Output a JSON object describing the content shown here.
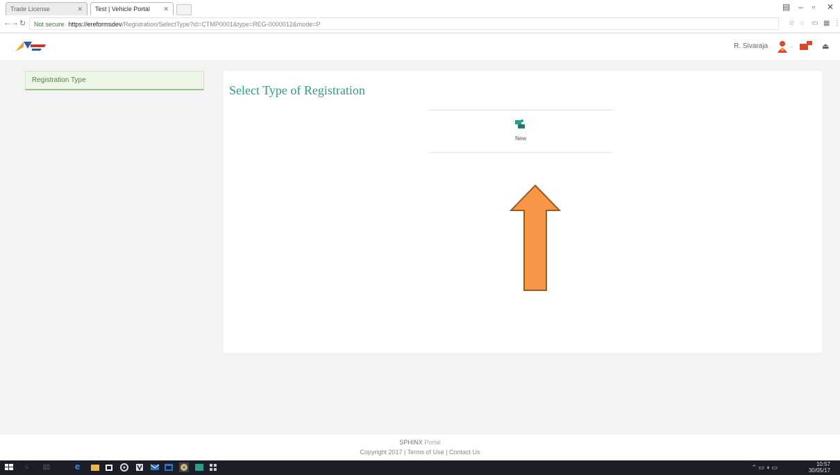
{
  "browser": {
    "tabs": [
      {
        "label": "Trade License"
      },
      {
        "label": "Test | Vehicle Portal"
      }
    ],
    "address": {
      "security": "Not secure",
      "host": "https://ereformsdev",
      "url": "/Registration/SelectType?id=CTMP0001&type=REG-0000012&mode=P"
    }
  },
  "header": {
    "username": "R. Sivaraja"
  },
  "sidebar": {
    "item_label": "Registration Type"
  },
  "main": {
    "title": "Select Type of Registration",
    "option_label": "New"
  },
  "annotation": {
    "arrow_color": "#f79646"
  },
  "footer": {
    "brand": "SPHINX",
    "brand_suffix": "Portal",
    "copyright": "Copyright 2017 | Terms of Use | Contact Us"
  },
  "taskbar": {
    "time": "10:57",
    "date": "30/05/17"
  },
  "colors": {
    "accent": "#2e9a8c",
    "sidebar_bg": "#edf5e6",
    "taskbar": "#1b1e26"
  }
}
